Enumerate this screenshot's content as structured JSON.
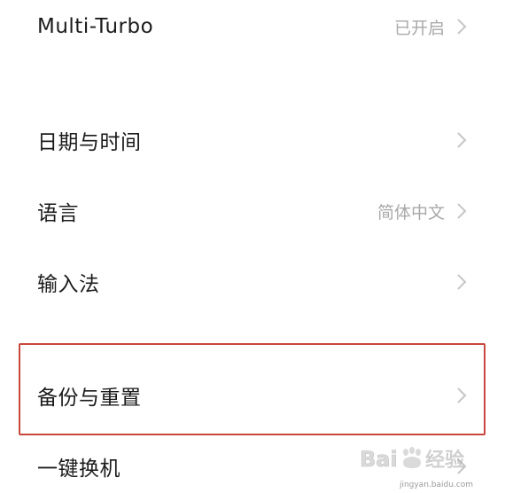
{
  "settings": {
    "rows": [
      {
        "label": "Multi-Turbo",
        "value": "已开启"
      },
      {
        "label": "日期与时间",
        "value": ""
      },
      {
        "label": "语言",
        "value": "简体中文"
      },
      {
        "label": "输入法",
        "value": ""
      },
      {
        "label": "备份与重置",
        "value": ""
      },
      {
        "label": "一键换机",
        "value": ""
      }
    ]
  },
  "watermark": {
    "brand": "Baidu经验",
    "url": "jingyan.baidu.com"
  },
  "colors": {
    "highlight": "#c8473e",
    "secondary_text": "#a9a9a9",
    "chevron": "#c6c6c6"
  }
}
